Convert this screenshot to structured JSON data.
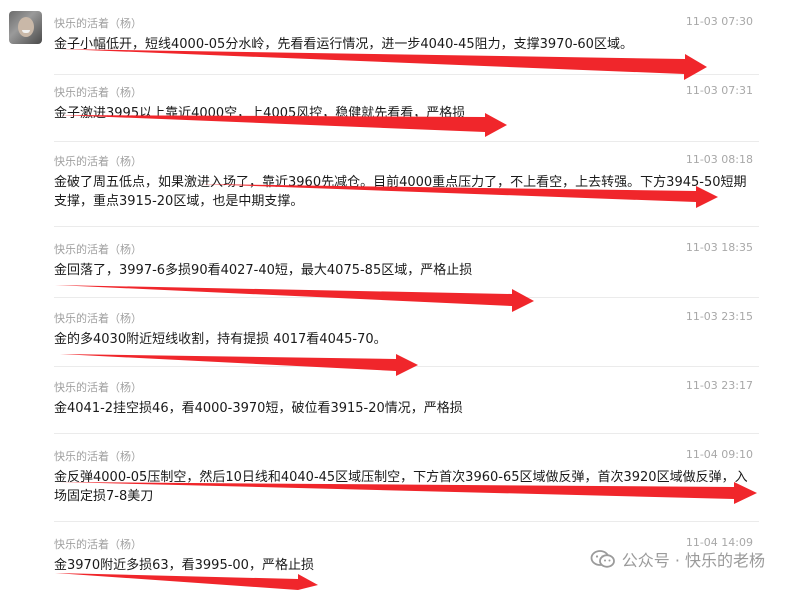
{
  "messages": [
    {
      "sender": "快乐的活着（杨）",
      "time": "11-03 07:30",
      "text": "金子小幅低开，短线4000-05分水岭，先看看运行情况，进一步4040-45阻力，支撑3970-60区域。"
    },
    {
      "sender": "快乐的活着（杨）",
      "time": "11-03 07:31",
      "text": "金子激进3995以上靠近4000空，上4005风控，稳健就先看看，严格损"
    },
    {
      "sender": "快乐的活着（杨）",
      "time": "11-03 08:18",
      "text": "金破了周五低点，如果激进入场了，靠近3960先减仓。目前4000重点压力了，不上看空，上去转强。下方3945-50短期支撑，重点3915-20区域，也是中期支撑。"
    },
    {
      "sender": "快乐的活着（杨）",
      "time": "11-03 18:35",
      "text": "金回落了，3997-6多损90看4027-40短，最大4075-85区域，严格止损"
    },
    {
      "sender": "快乐的活着（杨）",
      "time": "11-03 23:15",
      "text": "金的多4030附近短线收割，持有提损 4017看4045-70。"
    },
    {
      "sender": "快乐的活着（杨）",
      "time": "11-03 23:17",
      "text": "金4041-2挂空损46，看4000-3970短，破位看3915-20情况，严格损"
    },
    {
      "sender": "快乐的活着（杨）",
      "time": "11-04 09:10",
      "text": "金反弹4000-05压制空，然后10日线和4040-45区域压制空，下方首次3960-65区域做反弹，首次3920区域做反弹，入场固定损7-8美刀"
    },
    {
      "sender": "快乐的活着（杨）",
      "time": "11-04 14:09",
      "text": "金3970附近多损63，看3995-00，严格止损"
    }
  ],
  "watermark": {
    "text": "公众号 · 快乐的老杨",
    "icon": "wechat-icon"
  },
  "arrow_color": "#f0262b"
}
